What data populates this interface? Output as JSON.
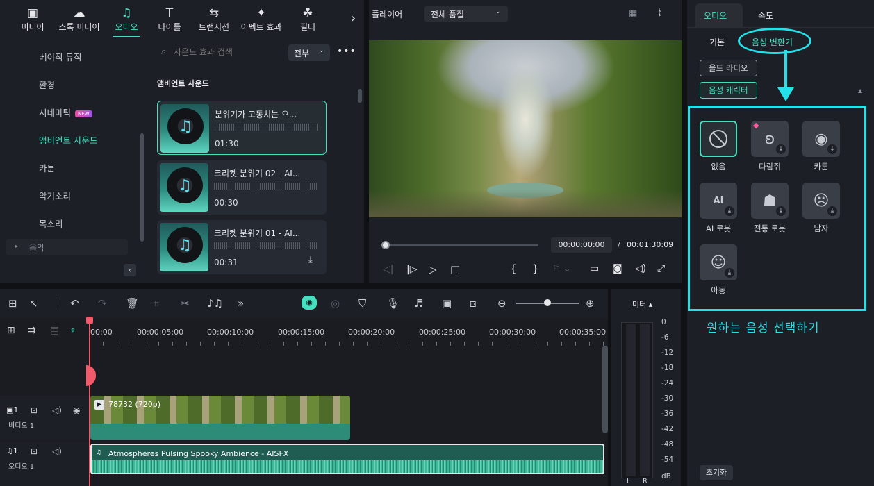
{
  "topbar": {
    "tools": [
      {
        "label": "미디어",
        "glyph": "▣",
        "icon": "media-icon"
      },
      {
        "label": "스톡 미디어",
        "glyph": "☁",
        "icon": "stock-media-icon"
      },
      {
        "label": "오디오",
        "glyph": "♫",
        "icon": "audio-icon"
      },
      {
        "label": "타이틀",
        "glyph": "T",
        "icon": "title-icon"
      },
      {
        "label": "트랜지션",
        "glyph": "⇆",
        "icon": "transition-icon"
      },
      {
        "label": "이펙트 효과",
        "glyph": "✦",
        "icon": "effects-icon"
      },
      {
        "label": "필터",
        "glyph": "☘",
        "icon": "filter-icon"
      }
    ],
    "more": "›"
  },
  "categories": [
    {
      "label": "베이직 뮤직"
    },
    {
      "label": "환경"
    },
    {
      "label": "시네마틱",
      "badge": "NEW"
    },
    {
      "label": "앰비언트 사운드"
    },
    {
      "label": "카툰"
    },
    {
      "label": "악기소리"
    },
    {
      "label": "목소리"
    },
    {
      "label": "음악"
    }
  ],
  "search": {
    "placeholder": "사운드 효과 검색",
    "filter": "전부"
  },
  "section_title": "앰비언트 사운드",
  "sounds": [
    {
      "title": "분위기가 고동치는 으...",
      "duration": "01:30"
    },
    {
      "title": "크리켓 분위기 02 - AI...",
      "duration": "00:30"
    },
    {
      "title": "크리켓 분위기 01 - AI...",
      "duration": "00:31"
    }
  ],
  "player": {
    "label": "플레이어",
    "quality": "전체 품질",
    "current_time": "00:00:00:00",
    "total_time": "00:01:30:09",
    "progress": 0,
    "separator": "/"
  },
  "rightpanel": {
    "tabs": [
      "오디오",
      "속도"
    ],
    "subtabs": [
      "기본",
      "음성 변환기"
    ],
    "pills": [
      "올드 라디오",
      "음성 캐릭터"
    ],
    "voices": [
      {
        "label": "없음",
        "icon": "none-icon",
        "glyph": "⃠"
      },
      {
        "label": "다람쥐",
        "icon": "squirrel-icon",
        "glyph": "🐿"
      },
      {
        "label": "카툰",
        "icon": "cartoon-icon",
        "glyph": "◉"
      },
      {
        "label": "AI 로봇",
        "icon": "ai-robot-icon",
        "glyph": "AI"
      },
      {
        "label": "전통 로봇",
        "icon": "robot-icon",
        "glyph": "☗"
      },
      {
        "label": "남자",
        "icon": "mask-icon",
        "glyph": "☹"
      },
      {
        "label": "아동",
        "icon": "child-icon",
        "glyph": "☺"
      }
    ],
    "annotation": "원하는 음성 선택하기",
    "reset": "초기화",
    "accent": "#45e0c0",
    "highlight": "#25e0e8"
  },
  "timeline": {
    "ticks": [
      "00:00",
      "00:00:05:00",
      "00:00:10:00",
      "00:00:15:00",
      "00:00:20:00",
      "00:00:25:00",
      "00:00:30:00",
      "00:00:35:00"
    ],
    "video_track": {
      "num": "1",
      "name": "비디오 1",
      "clip": "78732 (720p)"
    },
    "audio_track": {
      "num": "1",
      "name": "오디오 1",
      "clip": "Atmospheres Pulsing Spooky Ambience - AISFX"
    }
  },
  "meter": {
    "title": "미터",
    "scale": [
      "0",
      "-6",
      "-12",
      "-18",
      "-24",
      "-30",
      "-36",
      "-42",
      "-48",
      "-54",
      "dB"
    ],
    "channels": [
      "L",
      "R"
    ]
  }
}
